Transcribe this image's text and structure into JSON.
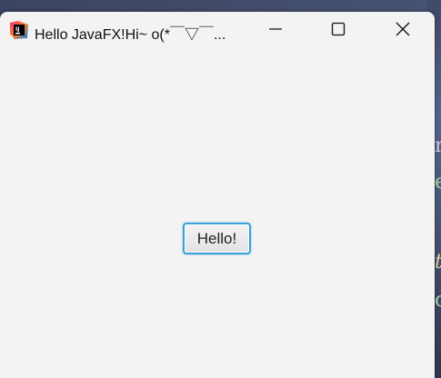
{
  "window": {
    "title": "Hello JavaFX!Hi~ o(*￣▽￣..."
  },
  "controls": {
    "minimize_icon": "minimize-icon",
    "maximize_icon": "maximize-icon",
    "close_icon": "close-icon"
  },
  "content": {
    "button_label": "Hello!"
  },
  "colors": {
    "window_bg": "#f3f3f3",
    "button_focus_border": "#3aa0d8"
  }
}
